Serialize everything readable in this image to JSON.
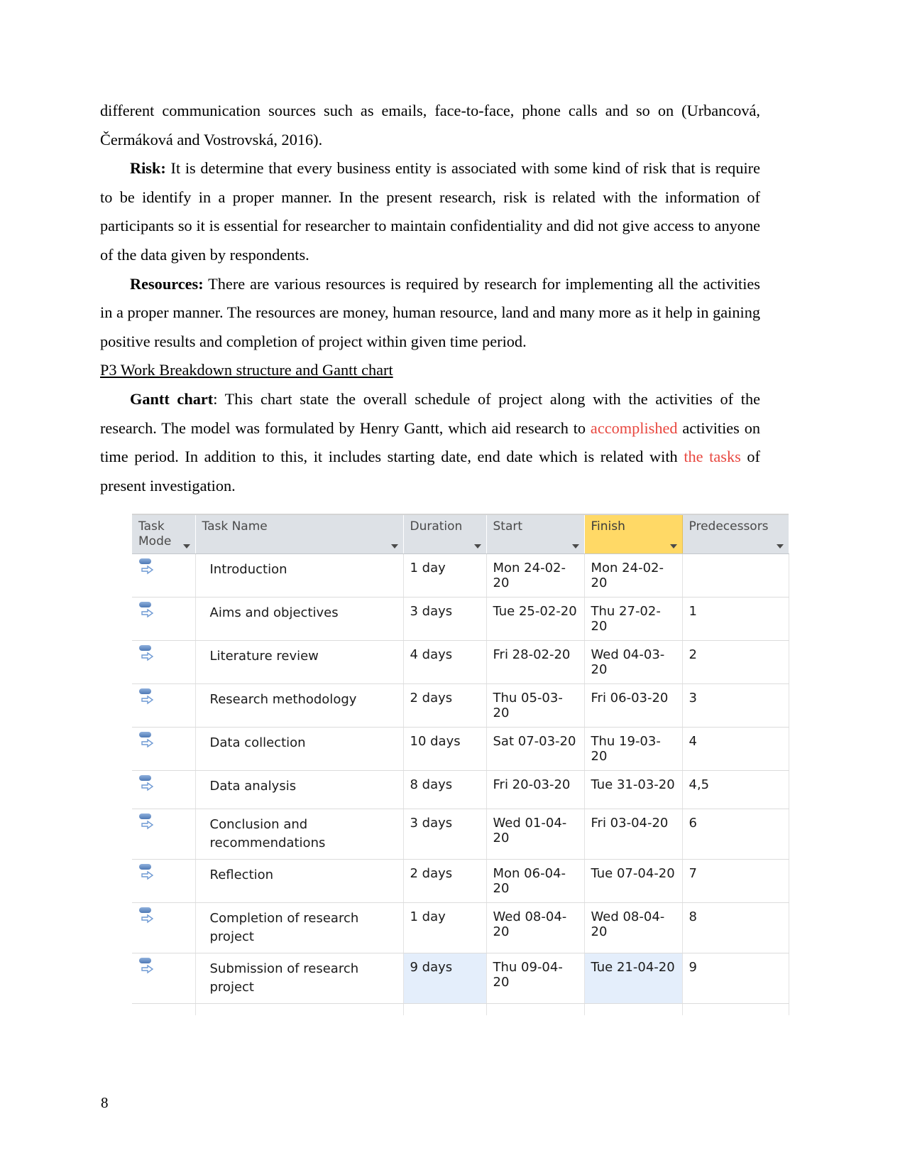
{
  "document": {
    "page_number": "8",
    "paragraphs": [
      {
        "id": "p-continued",
        "text": "different communication sources such as emails, face-to-face, phone calls and so on (Urbancová, Čermáková and Vostrovská, 2016)."
      },
      {
        "id": "p-risk",
        "lead": "Risk:",
        "text": " It is determine that every business entity is associated with some kind of risk that is require to be identify in a proper manner. In the present research, risk is related with the information of participants so it is essential for researcher to maintain confidentiality and did not give access to anyone of the data given by respondents."
      },
      {
        "id": "p-resources",
        "lead": "Resources:",
        "text": " There are various resources is required by research for implementing all the activities in a proper manner. The resources are money, human resource, land and many more as it help in gaining positive results and completion of project within given time period."
      }
    ],
    "heading": "P3  Work Breakdown structure and Gantt chart",
    "gantt_paragraph": {
      "lead": "Gantt chart",
      "part1": ": This chart state the overall schedule of project along with the activities of the research. The model was formulated by Henry Gantt, which aid research to ",
      "red1": "accomplished",
      "part2": " activities on time period. In addition to this, it includes starting date, end date which is related with ",
      "red2": "the tasks",
      "part3": " of present investigation."
    }
  },
  "project_table": {
    "columns": [
      {
        "key": "mode",
        "label": "Task Mode",
        "has_caret": true,
        "highlighted": false
      },
      {
        "key": "name",
        "label": "Task Name",
        "has_caret": true,
        "highlighted": false
      },
      {
        "key": "duration",
        "label": "Duration",
        "has_caret": true,
        "highlighted": false
      },
      {
        "key": "start",
        "label": "Start",
        "has_caret": true,
        "highlighted": false
      },
      {
        "key": "finish",
        "label": "Finish",
        "has_caret": true,
        "highlighted": true
      },
      {
        "key": "predecessors",
        "label": "Predecessors",
        "has_caret": true,
        "highlighted": false
      }
    ],
    "header_highlight_color": "#ffd966",
    "selection_highlight_color": "#e4eefb",
    "mode_icon": "auto-schedule-icon",
    "rows": [
      {
        "mode_icon": "auto-schedule-icon",
        "name": "Introduction",
        "duration": "1 day",
        "start": "Mon 24-02-20",
        "finish": "Mon 24-02-20",
        "predecessors": "",
        "selected": false
      },
      {
        "mode_icon": "auto-schedule-icon",
        "name": "Aims and objectives",
        "duration": "3 days",
        "start": "Tue 25-02-20",
        "finish": "Thu 27-02-20",
        "predecessors": "1",
        "selected": false
      },
      {
        "mode_icon": "auto-schedule-icon",
        "name": "Literature review",
        "duration": "4 days",
        "start": "Fri 28-02-20",
        "finish": "Wed 04-03-20",
        "predecessors": "2",
        "selected": false
      },
      {
        "mode_icon": "auto-schedule-icon",
        "name": "Research methodology",
        "duration": "2 days",
        "start": "Thu 05-03-20",
        "finish": "Fri 06-03-20",
        "predecessors": "3",
        "selected": false
      },
      {
        "mode_icon": "auto-schedule-icon",
        "name": "Data collection",
        "duration": "10 days",
        "start": "Sat 07-03-20",
        "finish": "Thu 19-03-20",
        "predecessors": "4",
        "selected": false
      },
      {
        "mode_icon": "auto-schedule-icon",
        "name": "Data analysis",
        "duration": "8 days",
        "start": "Fri 20-03-20",
        "finish": "Tue 31-03-20",
        "predecessors": "4,5",
        "selected": false
      },
      {
        "mode_icon": "auto-schedule-icon",
        "name": "Conclusion and recommendations",
        "duration": "3 days",
        "start": "Wed 01-04-20",
        "finish": "Fri 03-04-20",
        "predecessors": "6",
        "selected": false
      },
      {
        "mode_icon": "auto-schedule-icon",
        "name": "Reflection",
        "duration": "2 days",
        "start": "Mon 06-04-20",
        "finish": "Tue 07-04-20",
        "predecessors": "7",
        "selected": false
      },
      {
        "mode_icon": "auto-schedule-icon",
        "name": "Completion of research project",
        "duration": "1 day",
        "start": "Wed 08-04-20",
        "finish": "Wed 08-04-20",
        "predecessors": "8",
        "selected": false
      },
      {
        "mode_icon": "auto-schedule-icon",
        "name": "Submission of research project",
        "duration": "9 days",
        "start": "Thu 09-04-20",
        "finish": "Tue 21-04-20",
        "predecessors": "9",
        "selected": true
      }
    ]
  }
}
